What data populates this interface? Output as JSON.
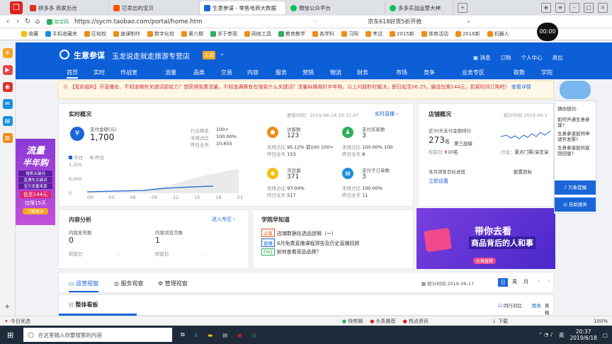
{
  "browser": {
    "tabs": [
      {
        "label": "拼多多 商家后台",
        "color": "#e02e24"
      },
      {
        "label": "已卖出的宝贝",
        "color": "#ff5000"
      },
      {
        "label": "生意参谋 - 零售电商大数据",
        "color": "#1a66d6"
      },
      {
        "label": "微信公众平台",
        "color": "#07c160"
      },
      {
        "label": "多多实战运营大神",
        "color": "#07c160"
      }
    ],
    "url": "https://sycm.taobao.com/portal/home.htm",
    "site_label": "淘宝网",
    "search_text": "京东618好货5折开抢",
    "bookmarks": [
      "收藏",
      "手机收藏夹",
      "区和校",
      "速课制作",
      "数字化校",
      "第六期",
      "关于参观",
      "网络工具",
      "教育教学",
      "各学科",
      "习网",
      "考试",
      "2015新",
      "体育活动",
      "2016新",
      "机器人",
      "00:00"
    ]
  },
  "header": {
    "brand": "生意参谋",
    "shop_name": "玉龙说走就走旅游专营店",
    "shop_badge": "主店",
    "right_links": [
      "消息",
      "订购",
      "个人中心",
      "退出"
    ],
    "nav": [
      "首页",
      "实时",
      "作战室",
      "流量",
      "品类",
      "交易",
      "内容",
      "服务",
      "营销",
      "物流",
      "财务",
      "市场",
      "竞争",
      "业务专区",
      "取数",
      "学院"
    ]
  },
  "notice": {
    "text": "【宽尚福利】开直播车、不知道哪些关键词更给力？想获得免费流量，不知道满赛有在搜索什么关键词？流量纵横限时半年购，以上问题秒时解决，即日起至06.25，最低仅需144元，抓紧时间订购吧！",
    "link": "查看详情"
  },
  "realtime": {
    "title": "实时概况",
    "update_time": "更新时间：2019-06-18 20:37:47",
    "live_link": "实时直播",
    "pay_label": "支付金额(元)",
    "pay_value": "1,700",
    "rank_label": "行业排名",
    "rank_value": "100+",
    "share_label": "无线占比",
    "share_value": "100.00%",
    "yesterday_label": "昨日全天",
    "yesterday_value": "10,655",
    "legend_today": "今日",
    "legend_yesterday": "昨日",
    "y_ticks": [
      "1,205",
      "6,000",
      "0"
    ],
    "x_ticks": [
      "00",
      "03",
      "06",
      "09",
      "12",
      "15",
      "18",
      "23"
    ],
    "metrics": [
      {
        "name": "访客数",
        "value": "123",
        "l1": "无线占比",
        "v1": "95.12%",
        "l2": "昨日全天",
        "v2": "153",
        "extra": "前100 100+",
        "color": "#f08c1a",
        "icon": "访"
      },
      {
        "name": "支付买家数",
        "value": "3",
        "l1": "无线占比",
        "v1": "100.00%",
        "l2": "昨日全天",
        "v2": "8",
        "extra": "100",
        "color": "#2fae5c",
        "icon": "买"
      },
      {
        "name": "浏览量",
        "value": "371",
        "l1": "无线占比",
        "v1": "97.04%",
        "l2": "昨日全天",
        "v2": "517",
        "extra": "",
        "color": "#f5c010",
        "icon": "浏"
      },
      {
        "name": "支付子订单数",
        "value": "3",
        "l1": "无线占比",
        "v1": "100.00%",
        "l2": "昨日全天",
        "v2": "11",
        "extra": "",
        "color": "#1a8fe0",
        "icon": "单"
      }
    ]
  },
  "shop": {
    "title": "店铺概况",
    "stat_time": "统计时间 2019-06-1",
    "pay_rank_label": "近30天支付金额排行",
    "rank_value": "273",
    "rank_unit": "名",
    "tier": "第三层级",
    "compare_label": "较前日",
    "compare_value": "10名",
    "industry_label": "行业：",
    "industry_value": "景点门票/演艺演",
    "sales_target_label": "本月销售目标进度",
    "setup_link": "立即设置",
    "config_label": "配置目标"
  },
  "content": {
    "title": "内容分析",
    "link": "进入专区",
    "items": [
      {
        "label": "内容发布数",
        "value": "0",
        "sub": "较前日",
        "sub_value": "-"
      },
      {
        "label": "内容浏览次数",
        "value": "1",
        "sub": "较前日",
        "sub_value": "-"
      }
    ]
  },
  "academy": {
    "title": "学院早知道",
    "items": [
      {
        "tag": "必看",
        "text": "店铺数据化选品逻辑（一）",
        "color": "#e05a1a"
      },
      {
        "tag": "直播",
        "text": "6月免费直播课程预告及历史直播回顾",
        "color": "#1a66d6"
      },
      {
        "tag": "FAQ",
        "text": "如何查看竞品品牌？",
        "color": "#2fae5c"
      }
    ]
  },
  "banner": {
    "line1": "带你去看",
    "line2": "商品背后的人和事",
    "badge": "价格直降"
  },
  "ops": {
    "tabs": [
      "运营视窗",
      "服务视窗",
      "管理视窗"
    ],
    "stat_time": "统计时间 2019-06-17",
    "periods": [
      "日",
      "周",
      "月"
    ],
    "board_title": "整体看板",
    "compare": "同行对比",
    "chart": "图表",
    "table": "表格"
  },
  "popup": {
    "title": "猜你想问:",
    "q1": "如何开通生意参谋?",
    "q2": "生意参谋如何申请开发票?",
    "q3": "生意参谋如何返回旧版?",
    "btn1": "万象提醒",
    "btn2": "自助服务"
  },
  "promo": {
    "line1": "流量",
    "line2": "半年购",
    "lines": [
      "搜索关键词",
      "直通车关键词",
      "宝贝流量来源"
    ],
    "price": "低至144元",
    "limit": "仅限15天",
    "cta": "了解更多"
  },
  "statusbar": {
    "left": "今日优选",
    "items": [
      "快剪辑",
      "头条推荐",
      "热点资讯",
      "下载"
    ],
    "zoom": "100%"
  },
  "taskbar": {
    "search": "在这里输入你要搜索的内容",
    "time": "20:37",
    "date": "2019/6/18",
    "lang": "英"
  },
  "clock_overlay": "00:00",
  "colors": {
    "brand": "#0d5fd8",
    "notice": "#fff8e6"
  }
}
